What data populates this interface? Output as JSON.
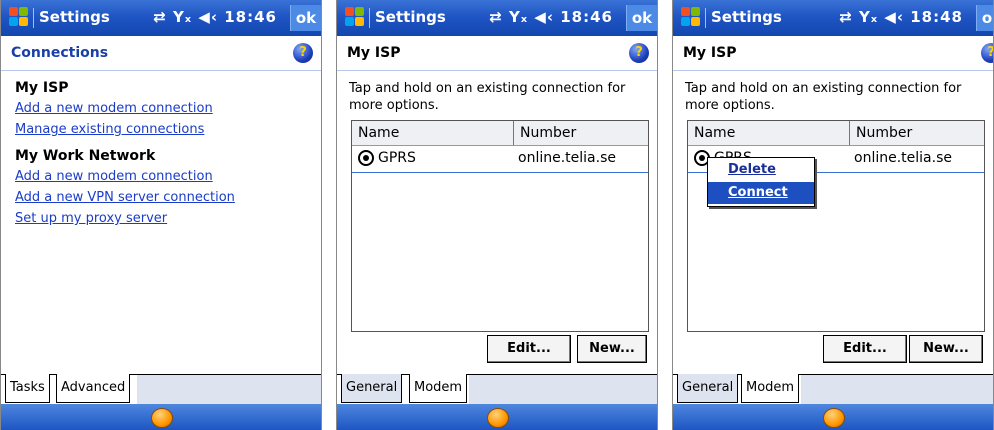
{
  "titlebar": {
    "title": "Settings",
    "ok": "ok"
  },
  "screens": [
    {
      "time": "18:46",
      "header": "Connections"
    },
    {
      "time": "18:46",
      "header": "My ISP"
    },
    {
      "time": "18:48",
      "header": "My ISP"
    }
  ],
  "tray_icons": [
    "connectivity-icon",
    "signal-icon",
    "volume-icon"
  ],
  "connections": {
    "my_isp": {
      "heading": "My ISP",
      "links": [
        "Add a new modem connection",
        "Manage existing connections"
      ]
    },
    "work": {
      "heading": "My Work Network",
      "links": [
        "Add a new modem connection",
        "Add a new VPN server connection",
        "Set up my proxy server"
      ]
    }
  },
  "isp": {
    "hint": "Tap and hold on an existing connection for more options.",
    "columns": [
      "Name",
      "Number"
    ],
    "row": {
      "name": "GPRS",
      "number": "online.telia.se"
    },
    "edit": "Edit...",
    "new": "New..."
  },
  "context_menu": {
    "delete": "Delete",
    "connect": "Connect"
  },
  "tabs1": [
    "Tasks",
    "Advanced"
  ],
  "tabs2": [
    "General",
    "Modem"
  ],
  "help_glyph": "?",
  "colors": {
    "titlebar": "#1f55c4",
    "link": "#1a3cc8",
    "selection": "#1d4fc0"
  }
}
